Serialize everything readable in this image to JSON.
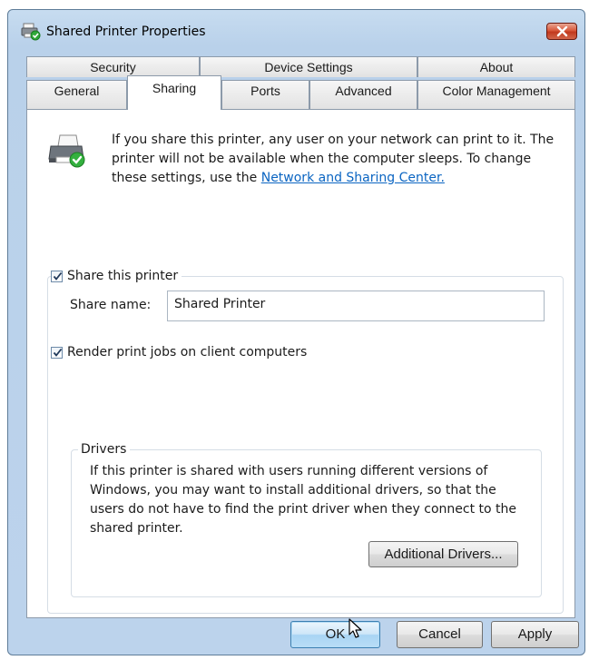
{
  "window": {
    "title": "Shared Printer Properties",
    "title_icon": "printer-shared-icon",
    "close_icon": "close-icon"
  },
  "tabs": {
    "row1": [
      "Security",
      "Device Settings",
      "About"
    ],
    "row2": [
      "General",
      "Sharing",
      "Ports",
      "Advanced",
      "Color Management"
    ],
    "active": "Sharing"
  },
  "sharing": {
    "intro_text": "If you share this printer, any user on your network can print to it. The printer will not be available when the computer sleeps. To change these settings, use the ",
    "intro_link": "Network and Sharing Center.",
    "share_checkbox_label": "Share this printer",
    "share_checked": true,
    "share_name_label": "Share name:",
    "share_name_value": "Shared Printer",
    "render_checkbox_label": "Render print jobs on client computers",
    "render_checked": true
  },
  "drivers": {
    "title": "Drivers",
    "text": "If this printer is shared with users running different versions of Windows, you may want to install additional drivers, so that the users do not have to find the print driver when they connect to the shared printer.",
    "button_label": "Additional Drivers..."
  },
  "buttons": {
    "ok": "OK",
    "cancel": "Cancel",
    "apply": "Apply"
  },
  "colors": {
    "accent": "#0b65c2",
    "window_frame": "#b9d1ea",
    "close_button": "#c1391e"
  }
}
